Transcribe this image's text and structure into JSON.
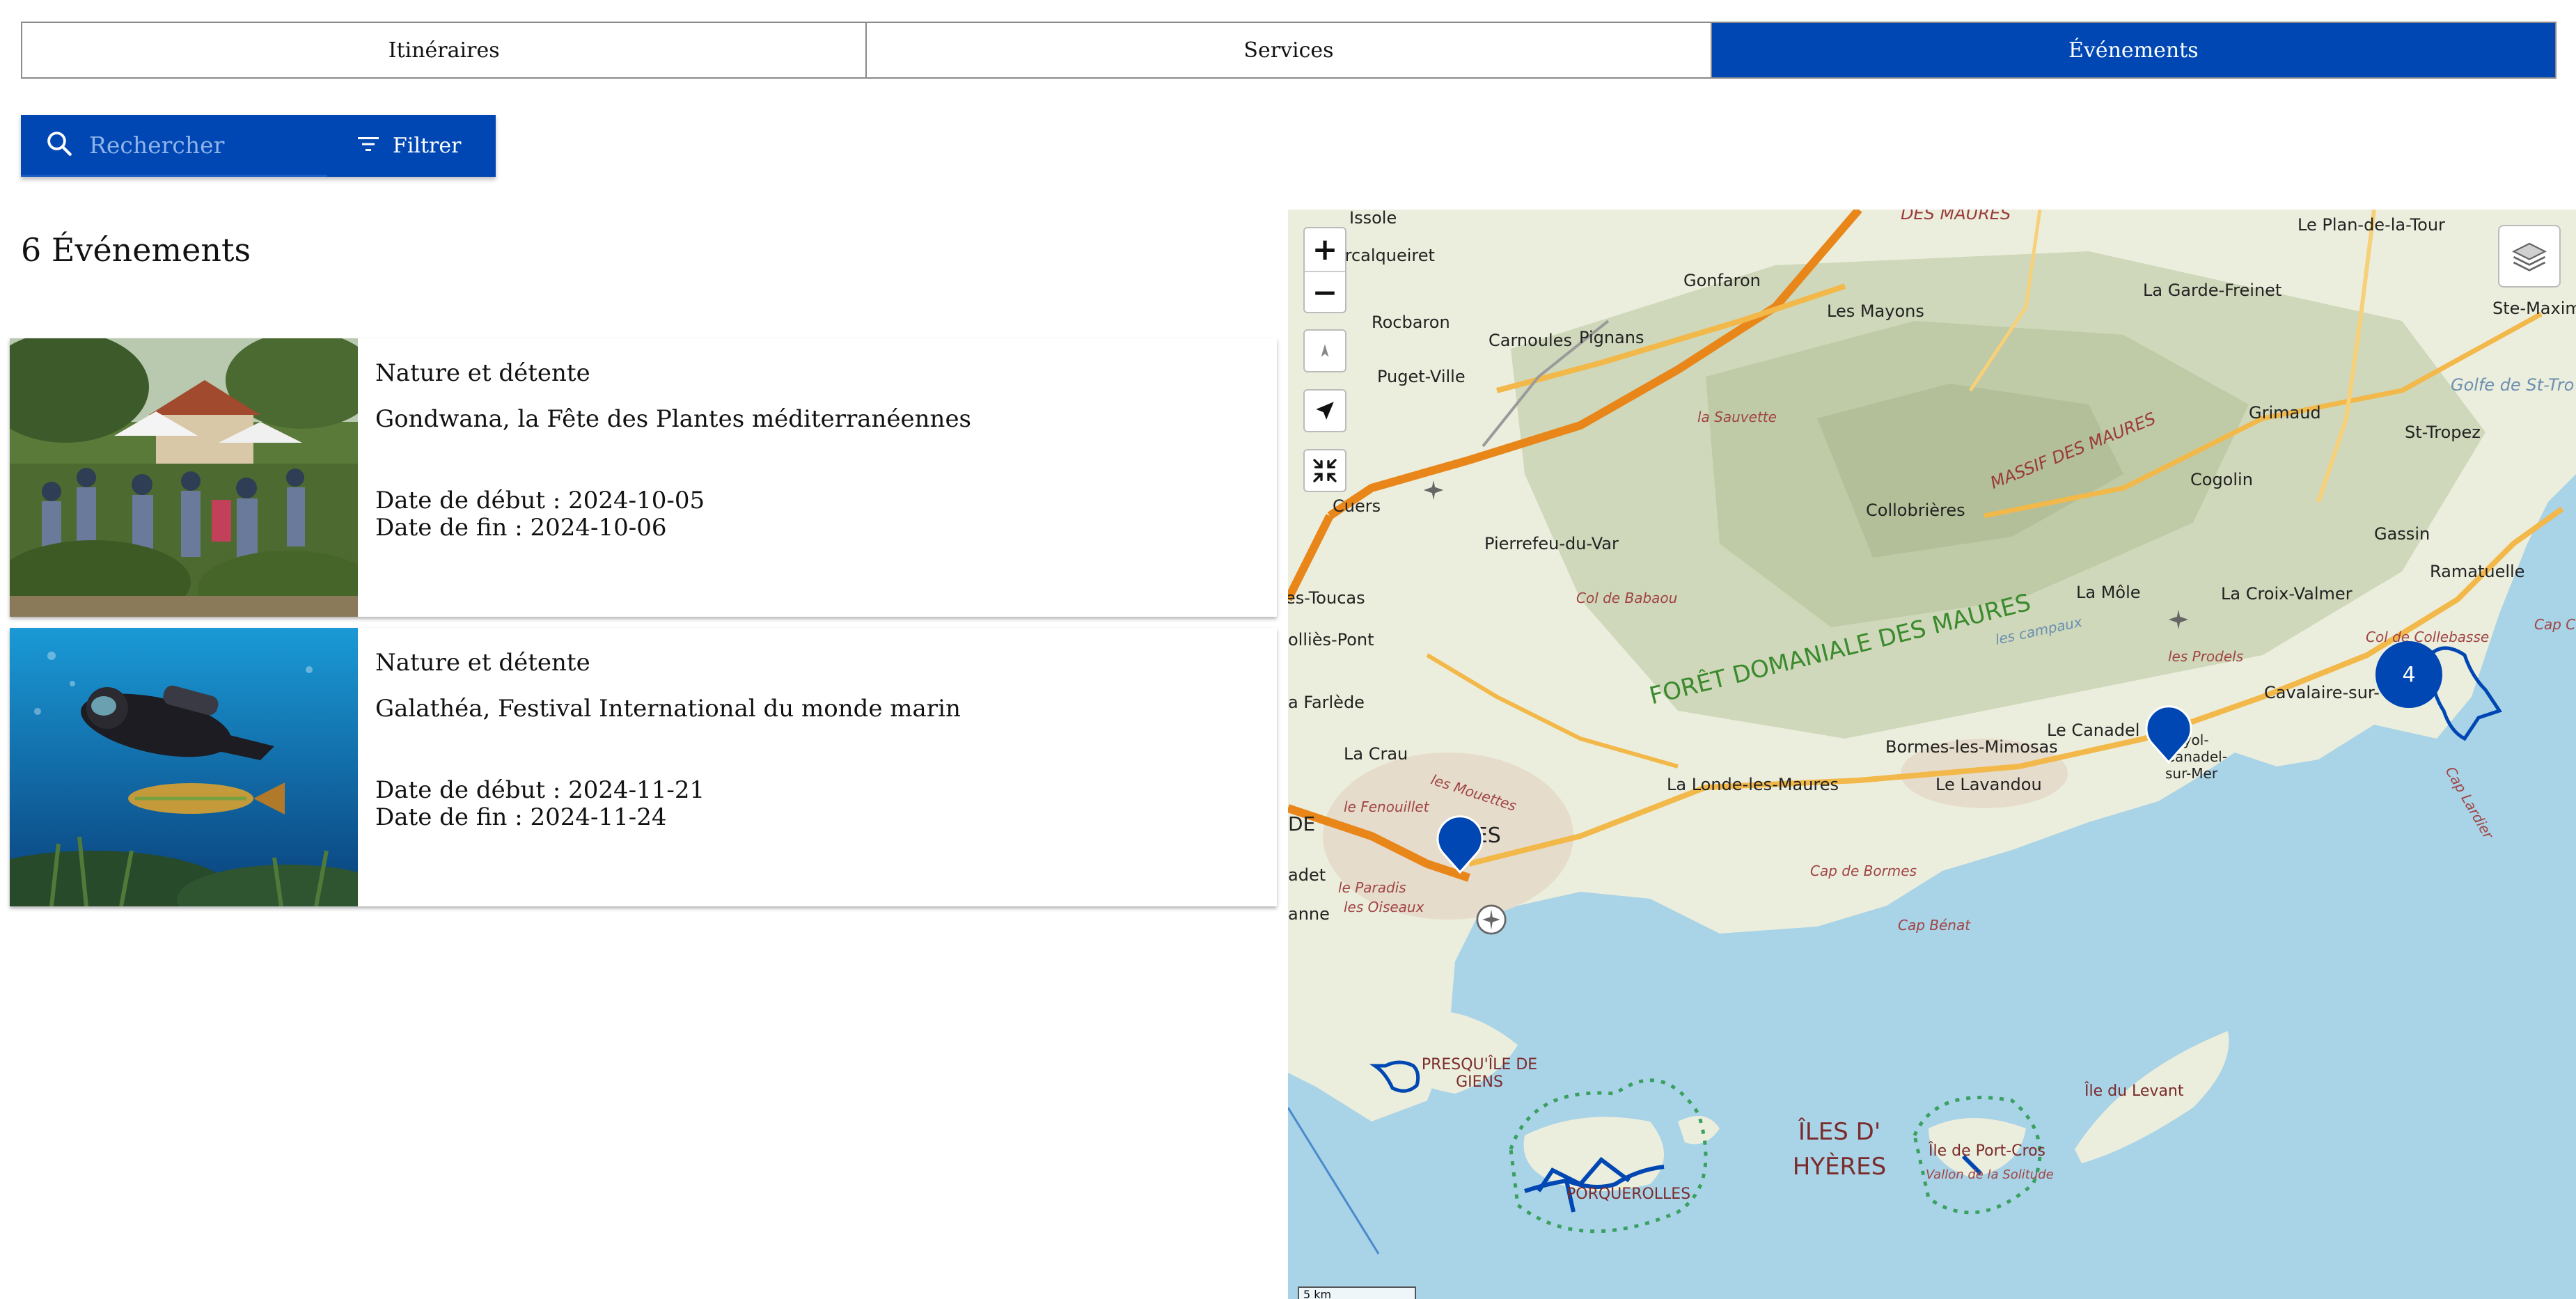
{
  "tabs": [
    {
      "label": "Itinéraires",
      "active": false
    },
    {
      "label": "Services",
      "active": false
    },
    {
      "label": "Événements",
      "active": true
    }
  ],
  "search": {
    "placeholder": "Rechercher",
    "filter_label": "Filtrer",
    "icon": "search-icon"
  },
  "results": {
    "count_label": "6 Événements"
  },
  "events": [
    {
      "category": "Nature et détente",
      "title": "Gondwana, la Fête des Plantes méditerranéennes",
      "start_date": "Date de début : 2024-10-05",
      "end_date": "Date de fin : 2024-10-06",
      "image": "garden-festival-photo"
    },
    {
      "category": "Nature et détente",
      "title": "Galathéa, Festival International du monde marin",
      "start_date": "Date de début : 2024-11-21",
      "end_date": "Date de fin : 2024-11-24",
      "image": "scuba-diver-photo"
    }
  ],
  "map": {
    "controls": {
      "zoom_in": "+",
      "zoom_out": "−"
    },
    "cluster_count": "4",
    "scale": "5 km",
    "labels": {
      "issole": "Issole",
      "forcalqueiret": "Forcalqueiret",
      "rocbaron": "Rocbaron",
      "carnoules": "Carnoules",
      "pignans": "Pignans",
      "gonfaron": "Gonfaron",
      "les_mayons": "Les Mayons",
      "la_garde_freinet": "La Garde-Freinet",
      "le_plan_de_la_tour": "Le Plan-de-la-Tour",
      "ste_maxime": "Ste-Maxim",
      "golfe_st_tropez": "Golfe de St-Tro",
      "st_tropez": "St-Tropez",
      "grimaud": "Grimaud",
      "puget_ville": "Puget-Ville",
      "cuers": "Cuers",
      "pierrefeu": "Pierrefeu-du-Var",
      "collobrieres": "Collobrières",
      "massif_maures": "MASSIF DES MAURES",
      "foret_maures": "FORÊT DOMANIALE DES MAURES",
      "cogolin": "Cogolin",
      "gassin": "Gassin",
      "ramatuelle": "Ramatuelle",
      "la_croix_valmer": "La Croix-Valmer",
      "la_mole": "La Môle",
      "cavalaire": "Cavalaire-sur-",
      "toucas": "es-Toucas",
      "sollies_pont": "olliès-Pont",
      "la_farlede": "a Farlède",
      "la_crau": "La Crau",
      "bormes": "Bormes-les-Mimosas",
      "le_canadel": "Le Canadel",
      "rayol": "Rayol-Canadel-sur-Mer",
      "la_londe": "La Londe-les-Maures",
      "le_lavandou": "Le Lavandou",
      "hyeres": "ÈRES",
      "cap_de_bormes": "Cap de Bormes",
      "cap_benat": "Cap Bénat",
      "presquile_giens": "PRESQU'ÎLE DE GIENS",
      "iles_hyeres": "ÎLES D' HYÈRES",
      "porquerolles": "PORQUEROLLES",
      "port_cros": "Île de Port-Cros",
      "vallon_solitude": "Vallon de la Solitude",
      "ile_levant": "Île du Levant",
      "col_babaou": "Col de Babaou",
      "la_sauvette": "la Sauvette",
      "col_collebasse": "Col de Collebasse",
      "cap_lardier": "Cap Lardier",
      "cap_cam": "Cap Cam",
      "les_prodels": "les Prodels",
      "les_campaux": "les campaux",
      "le_fenouillet": "le Fenouillet",
      "les_mouettes": "les Mouettes",
      "le_paradis": "le Paradis",
      "les_oiseaux": "les Oiseaux",
      "anne": "anne",
      "adet": "adet",
      "de": "DE",
      "des_maures_top": "DES MAURES"
    }
  }
}
